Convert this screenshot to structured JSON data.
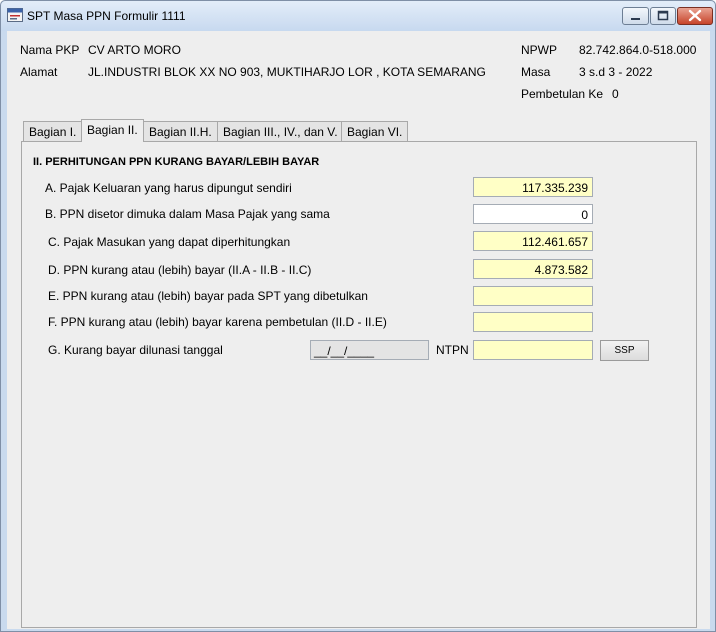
{
  "window": {
    "title": "SPT Masa PPN Formulir 1111",
    "app_icon": "form-app-icon",
    "controls": [
      "minimize-icon",
      "maximize-icon",
      "close-icon"
    ]
  },
  "header": {
    "nama_pkp_label": "Nama PKP",
    "nama_pkp_value": "CV ARTO MORO",
    "alamat_label": "Alamat",
    "alamat_value": "JL.INDUSTRI BLOK XX NO 903, MUKTIHARJO LOR , KOTA SEMARANG",
    "npwp_label": "NPWP",
    "npwp_value": "82.742.864.0-518.000",
    "masa_label": "Masa",
    "masa_value": "3 s.d 3 - 2022",
    "pembetulan_label": "Pembetulan Ke",
    "pembetulan_value": "0"
  },
  "tabs": [
    {
      "label": "Bagian I."
    },
    {
      "label": "Bagian II.",
      "active": true
    },
    {
      "label": "Bagian II.H."
    },
    {
      "label": "Bagian III., IV., dan V."
    },
    {
      "label": "Bagian VI."
    }
  ],
  "section": {
    "title": "II. PERHITUNGAN PPN KURANG BAYAR/LEBIH BAYAR",
    "rows": [
      {
        "label": "A. Pajak Keluaran yang harus dipungut sendiri",
        "value": "117.335.239",
        "editable": false
      },
      {
        "label": "B. PPN disetor dimuka dalam Masa Pajak yang sama",
        "value": "0",
        "editable": true
      },
      {
        "label": "C. Pajak Masukan yang dapat diperhitungkan",
        "value": "112.461.657",
        "editable": false
      },
      {
        "label": "D. PPN kurang atau (lebih) bayar (II.A - II.B - II.C)",
        "value": "4.873.582",
        "editable": false
      },
      {
        "label": "E. PPN kurang atau (lebih) bayar pada SPT yang dibetulkan",
        "value": "",
        "editable": false
      },
      {
        "label": "F. PPN kurang atau (lebih) bayar karena pembetulan (II.D - II.E)",
        "value": "",
        "editable": false
      }
    ],
    "row_g": {
      "label": "G. Kurang bayar dilunasi tanggal",
      "date_value": "__/__/____",
      "ntpn_label": "NTPN",
      "ntpn_value": "",
      "ssp_button": "SSP"
    }
  },
  "colors": {
    "readonly_field": "#ffffc6",
    "editable_field": "#ffffff",
    "panel_bg": "#eeeeee",
    "titlebar": "#c7d9ef",
    "close_button": "#c7442b"
  }
}
